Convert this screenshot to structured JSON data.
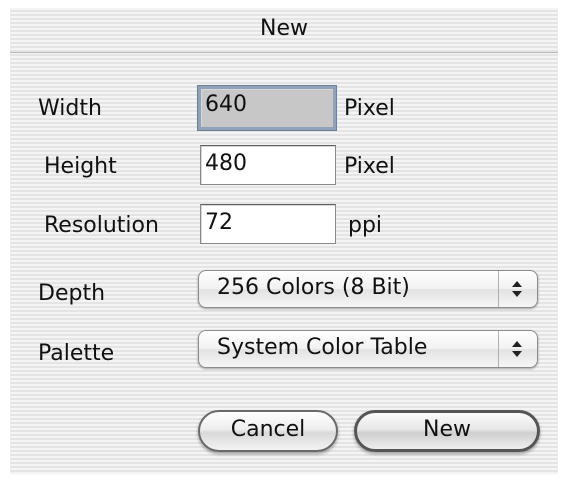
{
  "window": {
    "title": "New"
  },
  "form": {
    "width_label": "Width",
    "width_value": "640",
    "width_unit": "Pixel",
    "height_label": "Height",
    "height_value": "480",
    "height_unit": "Pixel",
    "resolution_label": "Resolution",
    "resolution_value": "72",
    "resolution_unit": "ppi",
    "depth_label": "Depth",
    "depth_selected": "256 Colors (8 Bit)",
    "palette_label": "Palette",
    "palette_selected": "System Color Table"
  },
  "buttons": {
    "cancel": "Cancel",
    "new": "New"
  },
  "icons": {
    "popup_arrows": "up-down-arrows-icon"
  }
}
